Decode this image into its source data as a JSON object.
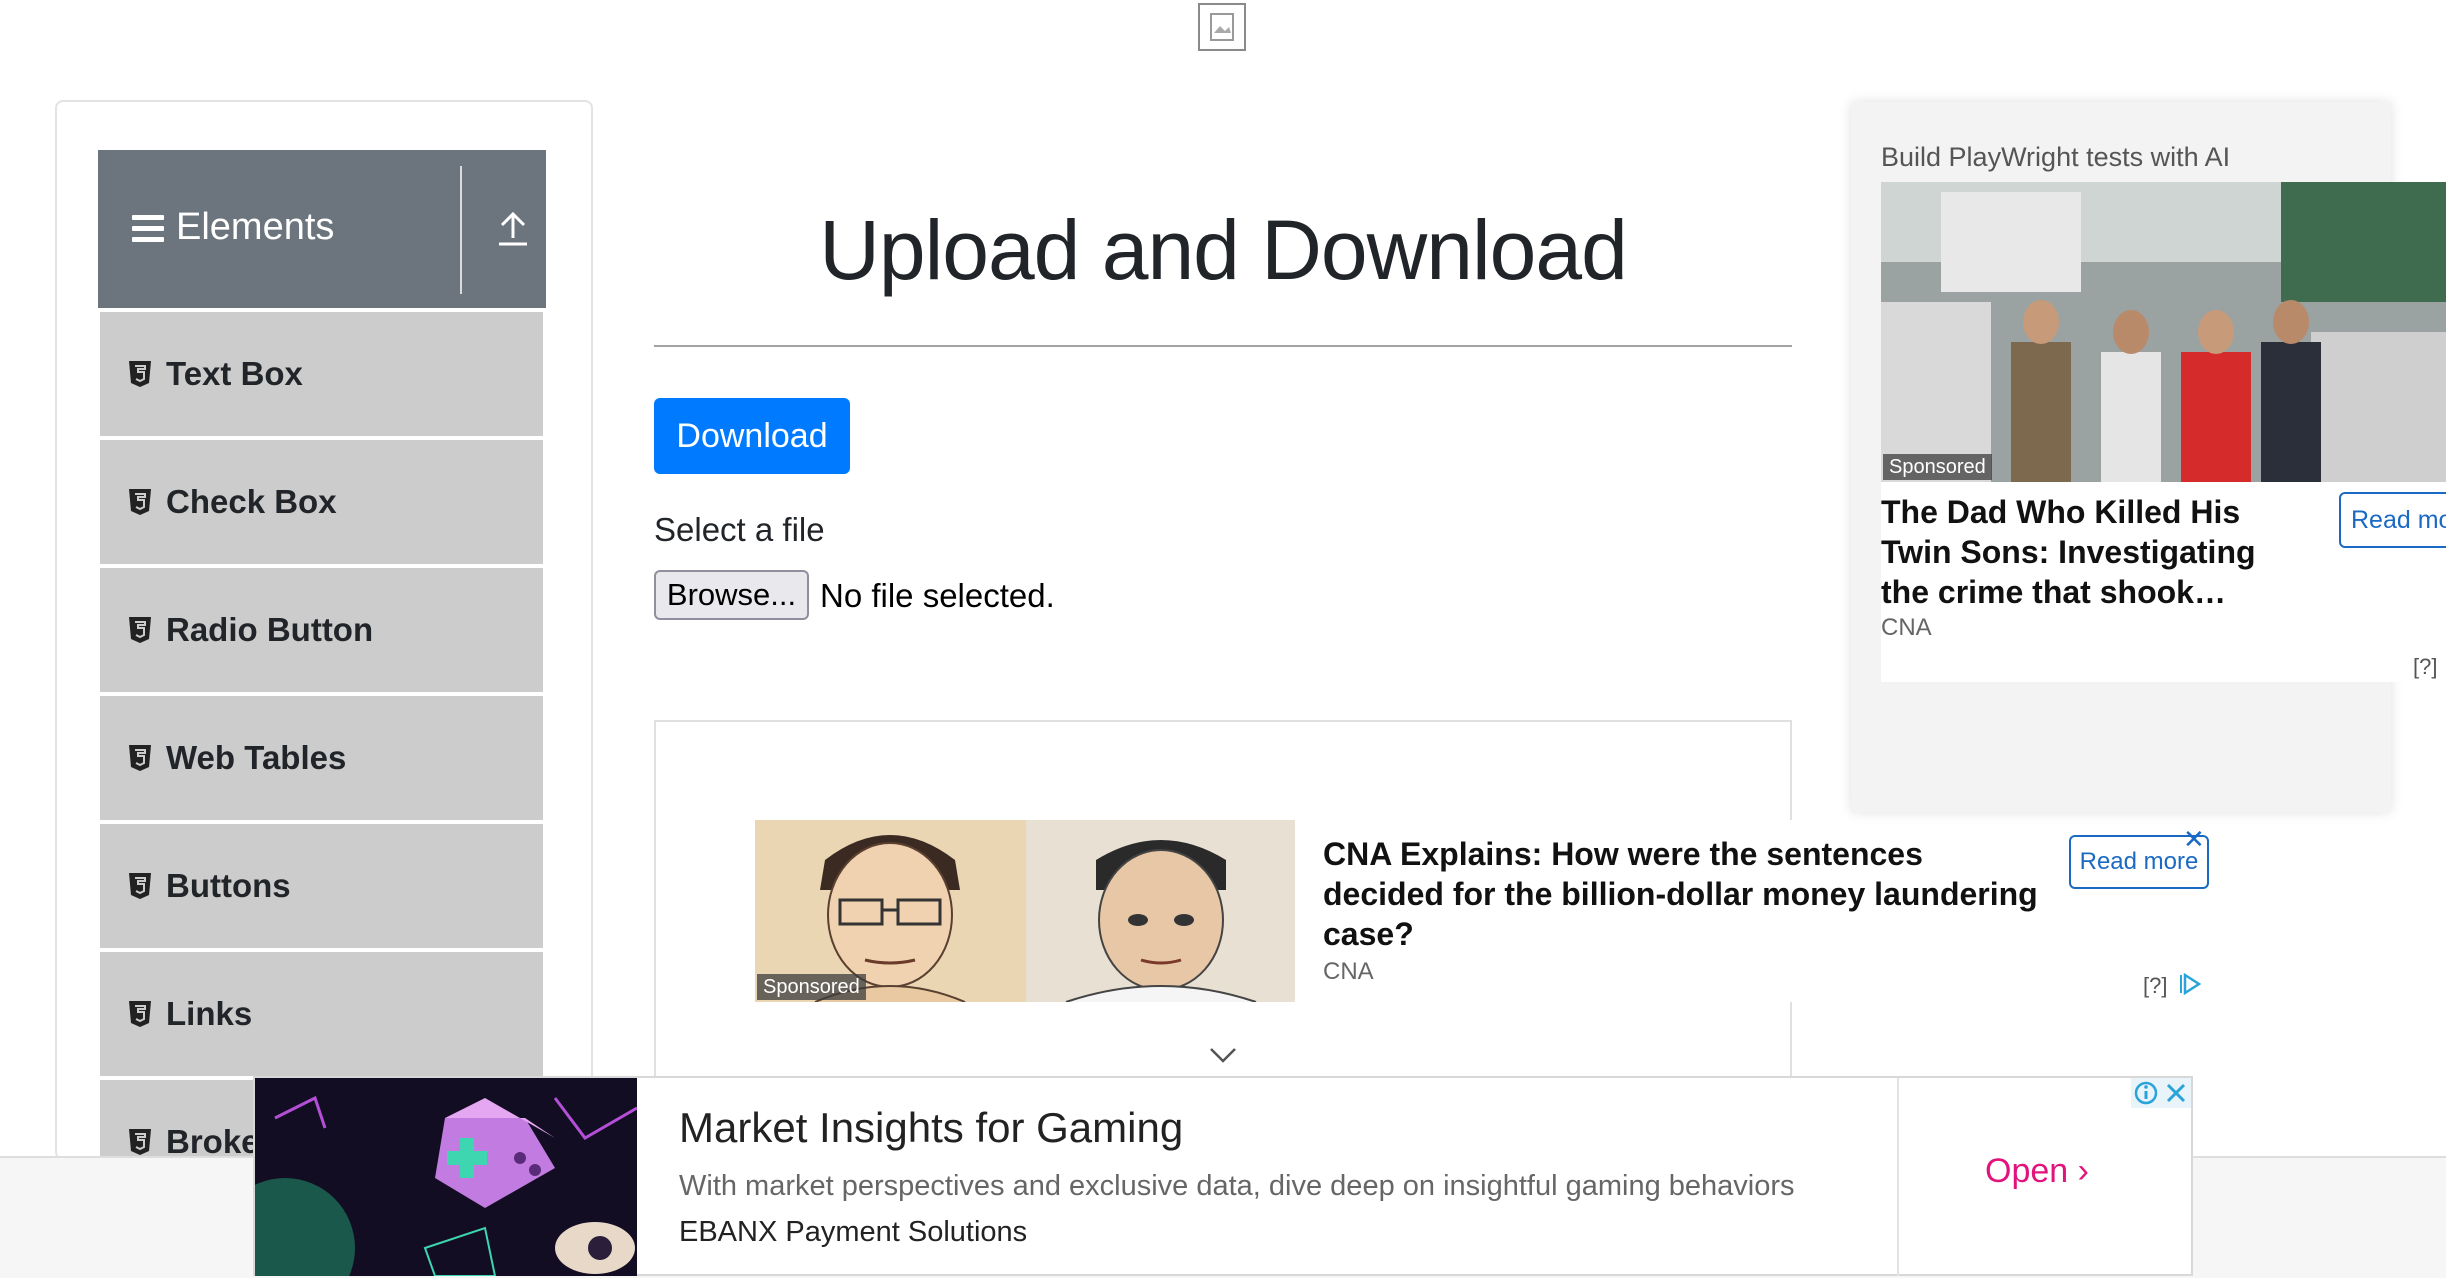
{
  "page": {
    "title": "Upload and Download"
  },
  "sidebar": {
    "group_title": "Elements",
    "items": [
      {
        "label": "Text Box"
      },
      {
        "label": "Check Box"
      },
      {
        "label": "Radio Button"
      },
      {
        "label": "Web Tables"
      },
      {
        "label": "Buttons"
      },
      {
        "label": "Links"
      },
      {
        "label": "Broke"
      }
    ]
  },
  "main": {
    "download_label": "Download",
    "select_label": "Select a file",
    "browse_label": "Browse...",
    "file_status": "No file selected."
  },
  "inline_ad": {
    "sponsored": "Sponsored",
    "headline": "CNA Explains: How were the sentences decided for the billion-dollar money laundering case?",
    "source": "CNA",
    "read_more": "Read more",
    "close": "✕",
    "help": "[?]"
  },
  "right_ad": {
    "title": "Build PlayWright tests with AI",
    "sponsored": "Sponsored",
    "headline": "The Dad Who Killed His Twin Sons: Investigating the crime that shook…",
    "source": "CNA",
    "read_more": "Read mo",
    "help": "[?]"
  },
  "bottom_ad": {
    "title": "Market Insights for Gaming",
    "description": "With market perspectives and exclusive data, dive deep on insightful gaming behaviors",
    "brand": "EBANX Payment Solutions",
    "open_label": "Open ›"
  },
  "colors": {
    "primary": "#007bff",
    "sidebar_header": "#6c757d",
    "menu_item": "#cccccc",
    "ad_link": "#1a6ac4",
    "open_accent": "#e0147c"
  },
  "icons": {
    "top": "broken-image-icon",
    "menu": "hamburger-icon",
    "collapse": "upload-arrow-icon",
    "item": "html5-shield-icon",
    "chevron": "chevron-down-icon"
  }
}
